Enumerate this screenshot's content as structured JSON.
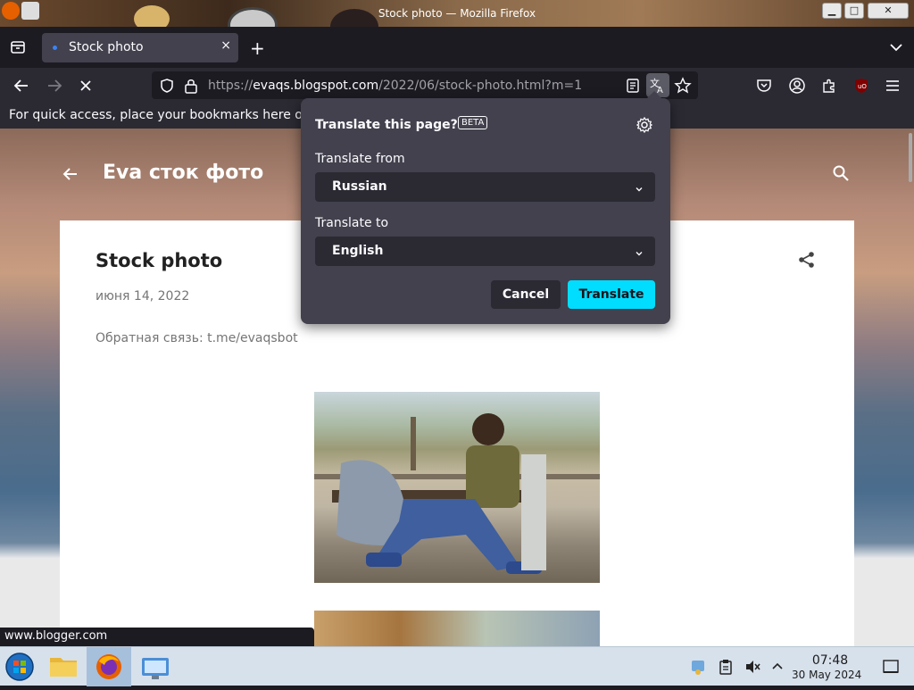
{
  "window": {
    "title": "Stock photo — Mozilla Firefox",
    "minimize": "▁",
    "maximize": "□",
    "close": "✕"
  },
  "tab": {
    "title": "Stock photo",
    "close": "×",
    "new_tab": "+"
  },
  "navbar": {
    "url_scheme": "https://",
    "url_host": "evaqs.blogspot.com",
    "url_path": "/2022/06/stock-photo.html?m=1"
  },
  "bookmarks": {
    "hint": "For quick access, place your bookmarks here on"
  },
  "page": {
    "brand": "Eva сток фото",
    "post_title": "Stock photo",
    "post_date": "июня 14, 2022",
    "post_body": "Обратная связь: t.me/evaqsbot"
  },
  "translate_popup": {
    "title": "Translate this page?",
    "badge": "BETA",
    "from_label": "Translate from",
    "from_value": "Russian",
    "to_label": "Translate to",
    "to_value": "English",
    "cancel": "Cancel",
    "translate": "Translate"
  },
  "status_bar": {
    "link": "www.blogger.com"
  },
  "taskbar": {
    "time": "07:48",
    "date": "30 May 2024"
  }
}
